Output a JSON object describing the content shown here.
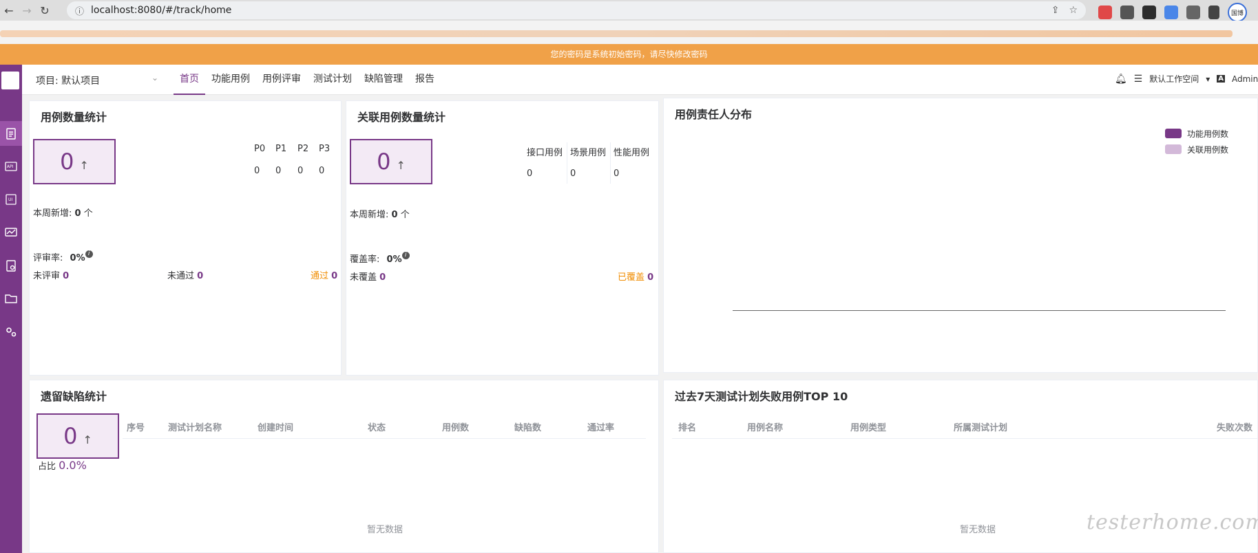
{
  "browser": {
    "url": "localhost:8080/#/track/home",
    "profile_label": "国博"
  },
  "banner": {
    "text": "您的密码是系统初始密码，请尽快修改密码"
  },
  "header": {
    "project_label": "项目: 默认项目",
    "tabs": [
      "首页",
      "功能用例",
      "用例评审",
      "测试计划",
      "缺陷管理",
      "报告"
    ],
    "workspace": "默认工作空间",
    "user": "Admini"
  },
  "case_stats": {
    "title": "用例数量统计",
    "total": "0",
    "arrow": "↑",
    "priorities": [
      {
        "label": "P0",
        "value": "0"
      },
      {
        "label": "P1",
        "value": "0"
      },
      {
        "label": "P2",
        "value": "0"
      },
      {
        "label": "P3",
        "value": "0"
      }
    ],
    "week_new_label": "本周新增:",
    "week_new_value": "0",
    "week_new_unit": "个",
    "review_rate_label": "评审率:",
    "review_rate_value": "0%",
    "unreviewed_label": "未评审",
    "unreviewed_value": "0",
    "failed_label": "未通过",
    "failed_value": "0",
    "passed_label": "通过",
    "passed_value": "0"
  },
  "related_stats": {
    "title": "关联用例数量统计",
    "total": "0",
    "arrow": "↑",
    "types": [
      {
        "label": "接口用例",
        "value": "0"
      },
      {
        "label": "场景用例",
        "value": "0"
      },
      {
        "label": "性能用例",
        "value": "0"
      }
    ],
    "week_new_label": "本周新增:",
    "week_new_value": "0",
    "week_new_unit": "个",
    "coverage_label": "覆盖率:",
    "coverage_value": "0%",
    "uncovered_label": "未覆盖",
    "uncovered_value": "0",
    "covered_label": "已覆盖",
    "covered_value": "0"
  },
  "owner_chart": {
    "title": "用例责任人分布",
    "legend": [
      {
        "name": "功能用例数",
        "color": "#783887"
      },
      {
        "name": "关联用例数",
        "color": "#d3b9d9"
      }
    ]
  },
  "defect_stats": {
    "title": "遗留缺陷统计",
    "total": "0",
    "arrow": "↑",
    "ratio_label": "占比",
    "ratio_value": "0.0%",
    "columns": [
      "序号",
      "测试计划名称",
      "创建时间",
      "状态",
      "用例数",
      "缺陷数",
      "通过率"
    ],
    "empty_text": "暂无数据"
  },
  "top10": {
    "title": "过去7天测试计划失败用例TOP 10",
    "columns": [
      "排名",
      "用例名称",
      "用例类型",
      "所属测试计划",
      "失败次数"
    ],
    "empty_text": "暂无数据"
  },
  "watermark": "testerhome.com"
}
